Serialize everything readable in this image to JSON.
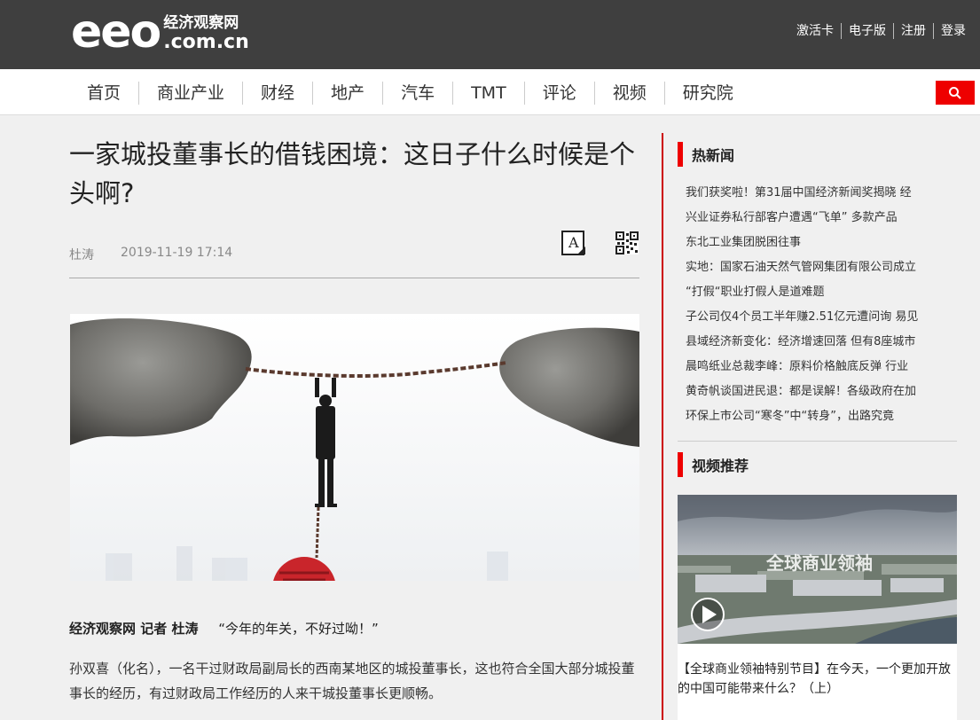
{
  "brand": {
    "logo_text": "eeo",
    "logo_cn": "经济观察网",
    "logo_domain": ".com.cn"
  },
  "top_links": [
    "激活卡",
    "电子版",
    "注册",
    "登录"
  ],
  "nav": [
    "首页",
    "商业产业",
    "财经",
    "地产",
    "汽车",
    "TMT",
    "评论",
    "视频",
    "研究院"
  ],
  "search": {
    "icon": "search-icon"
  },
  "article": {
    "title": "一家城投董事长的借钱困境：这日子什么时候是个头啊?",
    "author": "杜涛",
    "date": "2019-11-19 17:14",
    "lead_source": "经济观察网 记者 杜涛",
    "lead_quote": "“今年的年关，不好过呦！”",
    "paragraph": "孙双喜（化名），一名干过财政局副局长的西南某地区的城投董事长，这也符合全国大部分城投董事长的经历，有过财政局工作经历的人来干城投董事长更顺畅。"
  },
  "sidebar": {
    "hot_title": "热新闻",
    "hot_news": [
      "我们获奖啦！第31届中国经济新闻奖揭晓 经",
      "兴业证券私行部客户遭遇“飞单” 多款产品",
      "东北工业集团脱困往事",
      "实地：国家石油天然气管网集团有限公司成立",
      "“打假“职业打假人是道难题",
      "子公司仅4个员工半年赚2.51亿元遭问询 易见",
      "县域经济新变化：经济增速回落 但有8座城市",
      "晨鸣纸业总裁李峰：原料价格触底反弹 行业",
      "黄奇帆谈国进民退：都是误解！各级政府在加",
      "环保上市公司“寒冬”中“转身”，出路究竟"
    ],
    "video_title": "视频推荐",
    "video_overlay_text": "全球商业领袖",
    "video_caption": "【全球商业领袖特别节目】在今天，一个更加开放的中国可能带来什么？（上）"
  }
}
